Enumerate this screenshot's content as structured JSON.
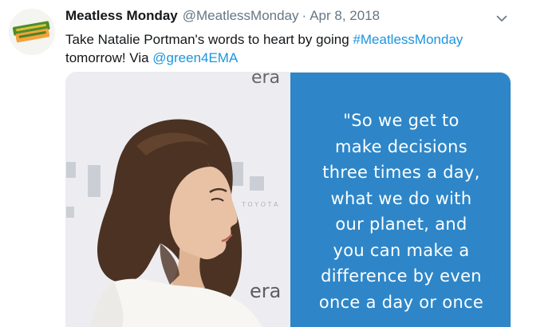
{
  "tweet": {
    "display_name": "Meatless Monday",
    "handle": "@MeatlessMonday",
    "separator": "·",
    "date": "Apr 8, 2018",
    "text": {
      "part1": "Take Natalie Portman's words to heart by going ",
      "hashtag": "#MeatlessMonday",
      "part2": "tomorrow! Via ",
      "mention": "@green4EMA"
    },
    "avatar_logo": "MEATLESS MONDAY",
    "menu_icon": "chevron-down-icon"
  },
  "media": {
    "backdrop_text": "era",
    "backdrop_text_lower": "era",
    "quote_lines": [
      "\"So we get to",
      "make decisions",
      "three times a day,",
      "what we do with",
      "our planet, and",
      "you can make a",
      "difference by even",
      "once a day or once"
    ]
  },
  "colors": {
    "link": "#1b95e0",
    "secondary_text": "#657786",
    "quote_panel": "#2e86c8",
    "logo_green": "#4a8f2a",
    "logo_orange": "#f2a33a"
  }
}
